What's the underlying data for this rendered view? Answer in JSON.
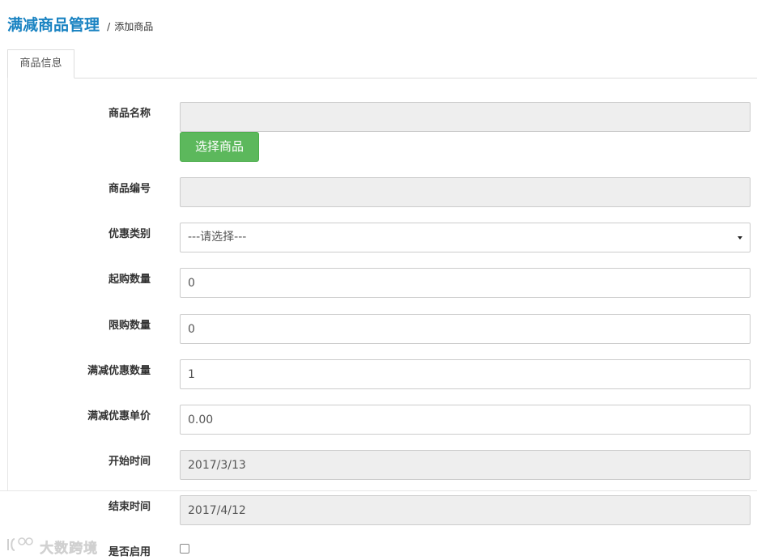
{
  "header": {
    "title": "满减商品管理",
    "separator": "/",
    "subtitle": "添加商品"
  },
  "tabs": [
    {
      "label": "商品信息",
      "active": true
    }
  ],
  "form": {
    "product_name": {
      "label": "商品名称",
      "value": ""
    },
    "select_product_button": "选择商品",
    "product_code": {
      "label": "商品编号",
      "value": ""
    },
    "discount_type": {
      "label": "优惠类别",
      "selected": "---请选择---"
    },
    "min_purchase": {
      "label": "起购数量",
      "value": "0"
    },
    "max_purchase": {
      "label": "限购数量",
      "value": "0"
    },
    "full_reduction_qty": {
      "label": "满减优惠数量",
      "value": "1"
    },
    "full_reduction_price": {
      "label": "满减优惠单价",
      "value": "0.00"
    },
    "start_time": {
      "label": "开始时间",
      "value": "2017/3/13"
    },
    "end_time": {
      "label": "结束时间",
      "value": "2017/4/12"
    },
    "enabled": {
      "label": "是否启用",
      "checked": false
    }
  },
  "watermark": {
    "text": "大数跨境"
  },
  "colors": {
    "title": "#1a83c2",
    "button": "#5cb85c",
    "readonly_bg": "#eeeeee",
    "border": "#cccccc"
  }
}
